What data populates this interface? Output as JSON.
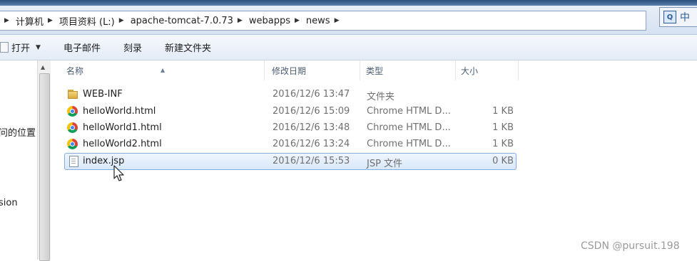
{
  "address_bar": {
    "breadcrumbs": [
      "计算机",
      "项目资料 (L:)",
      "apache-tomcat-7.0.73",
      "webapps",
      "news"
    ]
  },
  "ime": {
    "label": "中"
  },
  "toolbar": {
    "open_label": "打开",
    "email_label": "电子邮件",
    "burn_label": "刻录",
    "new_folder_label": "新建文件夹"
  },
  "nav_pane": {
    "partial_items": [
      "问的位置",
      "sion"
    ]
  },
  "columns": {
    "name": "名称",
    "modified": "修改日期",
    "type": "类型",
    "size": "大小"
  },
  "files": [
    {
      "icon": "folder-icon",
      "name": "WEB-INF",
      "modified": "2016/12/6 13:47",
      "type": "文件夹",
      "size": ""
    },
    {
      "icon": "chrome-icon",
      "name": "helloWorld.html",
      "modified": "2016/12/6 15:09",
      "type": "Chrome HTML D...",
      "size": "1 KB"
    },
    {
      "icon": "chrome-icon",
      "name": "helloWorld1.html",
      "modified": "2016/12/6 13:48",
      "type": "Chrome HTML D...",
      "size": "1 KB"
    },
    {
      "icon": "chrome-icon",
      "name": "helloWorld2.html",
      "modified": "2016/12/6 13:24",
      "type": "Chrome HTML D...",
      "size": "1 KB"
    },
    {
      "icon": "document-icon",
      "name": "index.jsp",
      "modified": "2016/12/6 15:53",
      "type": "JSP 文件",
      "size": "0 KB"
    }
  ],
  "watermark": "CSDN @pursuit.198"
}
